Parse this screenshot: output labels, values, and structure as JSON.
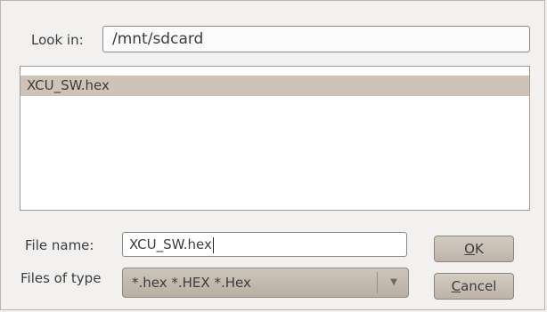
{
  "dialog": {
    "look_in_label": "Look in:",
    "look_in_path": "/mnt/sdcard",
    "files": [
      {
        "name": "XCU_SW.hex",
        "selected": true
      }
    ],
    "file_name_label": "File name:",
    "file_name_value": "XCU_SW.hex",
    "files_of_type_label": "Files of type",
    "files_of_type_value": "*.hex *.HEX *.Hex",
    "ok_mnemonic": "O",
    "ok_rest": "K",
    "cancel_mnemonic": "C",
    "cancel_rest": "ancel"
  },
  "colors": {
    "selection": "#cfc3b7",
    "background": "#f2f1f0"
  },
  "icons": {
    "combo_arrow": "chevron-down-icon"
  }
}
